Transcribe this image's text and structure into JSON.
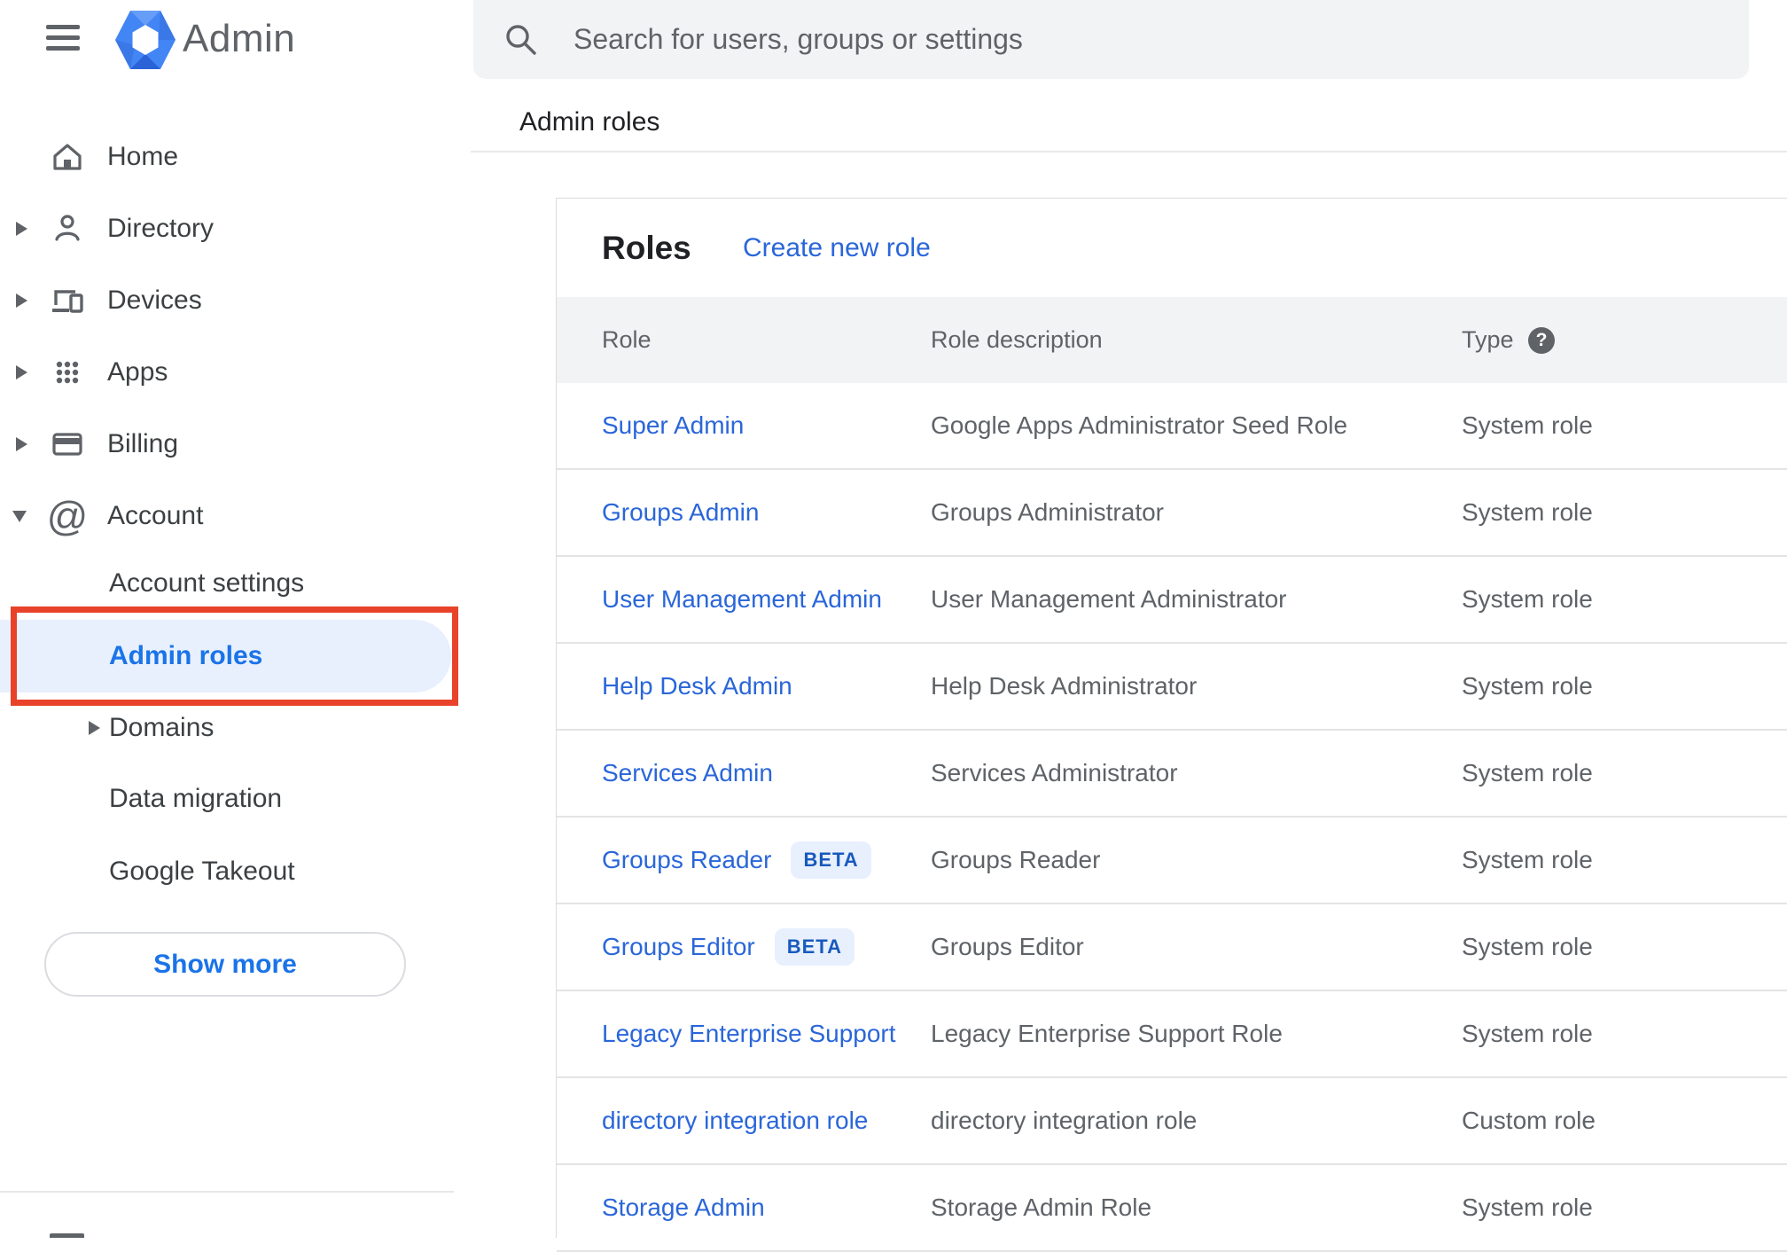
{
  "app": {
    "title": "Admin"
  },
  "search": {
    "placeholder": "Search for users, groups or settings"
  },
  "sidebar": {
    "items": [
      {
        "label": "Home"
      },
      {
        "label": "Directory"
      },
      {
        "label": "Devices"
      },
      {
        "label": "Apps"
      },
      {
        "label": "Billing"
      },
      {
        "label": "Account"
      }
    ],
    "sub_items": [
      {
        "label": "Account settings"
      },
      {
        "label": "Admin roles",
        "selected": true
      },
      {
        "label": "Domains"
      },
      {
        "label": "Data migration"
      },
      {
        "label": "Google Takeout"
      }
    ],
    "show_more_label": "Show more"
  },
  "breadcrumb": "Admin roles",
  "roles_card": {
    "title": "Roles",
    "create_link": "Create new role",
    "columns": [
      "Role",
      "Role description",
      "Type"
    ],
    "type_help_icon": "?",
    "rows": [
      {
        "role": "Super Admin",
        "badge": "",
        "description": "Google Apps Administrator Seed Role",
        "type": "System role"
      },
      {
        "role": "Groups Admin",
        "badge": "",
        "description": "Groups Administrator",
        "type": "System role"
      },
      {
        "role": "User Management Admin",
        "badge": "",
        "description": "User Management Administrator",
        "type": "System role"
      },
      {
        "role": "Help Desk Admin",
        "badge": "",
        "description": "Help Desk Administrator",
        "type": "System role"
      },
      {
        "role": "Services Admin",
        "badge": "",
        "description": "Services Administrator",
        "type": "System role"
      },
      {
        "role": "Groups Reader",
        "badge": "BETA",
        "description": "Groups Reader",
        "type": "System role"
      },
      {
        "role": "Groups Editor",
        "badge": "BETA",
        "description": "Groups Editor",
        "type": "System role"
      },
      {
        "role": "Legacy Enterprise Support",
        "badge": "",
        "description": "Legacy Enterprise Support Role",
        "type": "System role"
      },
      {
        "role": "directory integration role",
        "badge": "",
        "description": "directory integration role",
        "type": "Custom role"
      },
      {
        "role": "Storage Admin",
        "badge": "",
        "description": "Storage Admin Role",
        "type": "System role"
      }
    ]
  },
  "colors": {
    "accent_blue": "#1a73e8",
    "link_blue": "#2a66d9",
    "selected_bg": "#e8f0fe",
    "annotation_red": "#e8432a",
    "table_header_bg": "#f1f3f4",
    "icon_gray": "#5f6368",
    "badge_bg": "#e8f0fe",
    "badge_text": "#185abc"
  }
}
